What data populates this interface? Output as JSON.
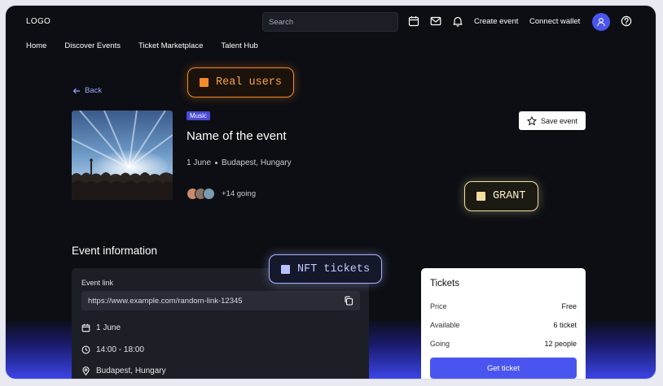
{
  "header": {
    "logo": "LOGO",
    "search_placeholder": "Search",
    "create_event": "Create event",
    "connect_wallet": "Connect wallet",
    "icons": [
      "calendar-icon",
      "mail-icon",
      "bell-icon",
      "user-icon",
      "help-icon"
    ]
  },
  "nav": {
    "items": [
      {
        "label": "Home"
      },
      {
        "label": "Discover Events"
      },
      {
        "label": "Ticket Marketplace"
      },
      {
        "label": "Talent Hub"
      }
    ]
  },
  "event": {
    "back_label": "Back",
    "category": "Music",
    "title": "Name of the event",
    "date": "1 June",
    "location": "Budapest, Hungary",
    "going_label": "+14 going",
    "save_label": "Save event"
  },
  "tags": {
    "real_users": "Real users",
    "grant": "GRANT",
    "nft_tickets": "NFT tickets"
  },
  "info": {
    "section_title": "Event information",
    "link_label": "Event link",
    "link_value": "https://www.example.com/random-link-12345",
    "date": "1 June",
    "time": "14:00 - 18:00",
    "location": "Budapest, Hungary"
  },
  "tickets": {
    "title": "Tickets",
    "rows": [
      {
        "key": "Price",
        "value": "Free"
      },
      {
        "key": "Available",
        "value": "6 ticket"
      },
      {
        "key": "Going",
        "value": "12 people"
      }
    ],
    "cta": "Get ticket"
  },
  "colors": {
    "accent": "#4a55f0",
    "real_users": "#f48a2a",
    "grant": "#f3df9e",
    "nft": "#a9b4ff",
    "background": "#0c0e13"
  }
}
